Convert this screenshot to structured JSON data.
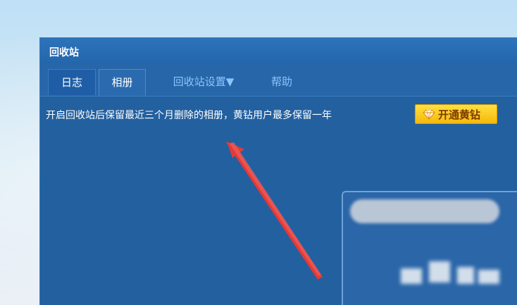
{
  "window": {
    "title": "回收站"
  },
  "tabs": [
    {
      "label": "日志"
    },
    {
      "label": "相册"
    },
    {
      "label": "回收站设置▼"
    },
    {
      "label": "帮助"
    }
  ],
  "notice_text": "开启回收站后保留最近三个月删除的相册，黄钻用户最多保留一年",
  "yellow_button": {
    "label": "开通黄钻",
    "icon": "diamond-icon"
  },
  "colors": {
    "window_bg": "#23609f",
    "link": "#8cc4ff",
    "accent_yellow": "#f5b80a",
    "annotation_arrow": "#e53935"
  }
}
